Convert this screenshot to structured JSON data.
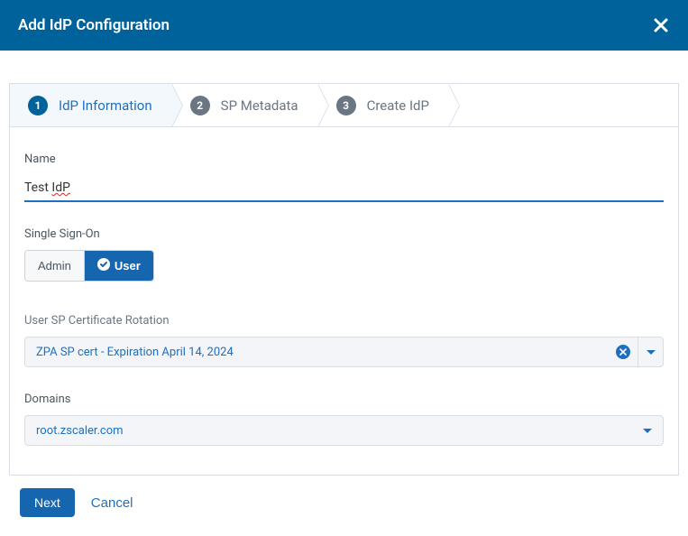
{
  "header": {
    "title": "Add IdP Configuration"
  },
  "wizard": {
    "steps": [
      {
        "num": "1",
        "label": "IdP Information",
        "active": true
      },
      {
        "num": "2",
        "label": "SP Metadata",
        "active": false
      },
      {
        "num": "3",
        "label": "Create IdP",
        "active": false
      }
    ]
  },
  "form": {
    "name_label": "Name",
    "name_value_prefix": "Test ",
    "name_value_spellchecked": "IdP",
    "sso_label": "Single Sign-On",
    "sso_options": {
      "admin": "Admin",
      "user": "User"
    },
    "cert_label": "User SP Certificate Rotation",
    "cert_value": "ZPA SP cert - Expiration April 14, 2024",
    "domains_label": "Domains",
    "domains_value": "root.zscaler.com"
  },
  "footer": {
    "next": "Next",
    "cancel": "Cancel"
  }
}
